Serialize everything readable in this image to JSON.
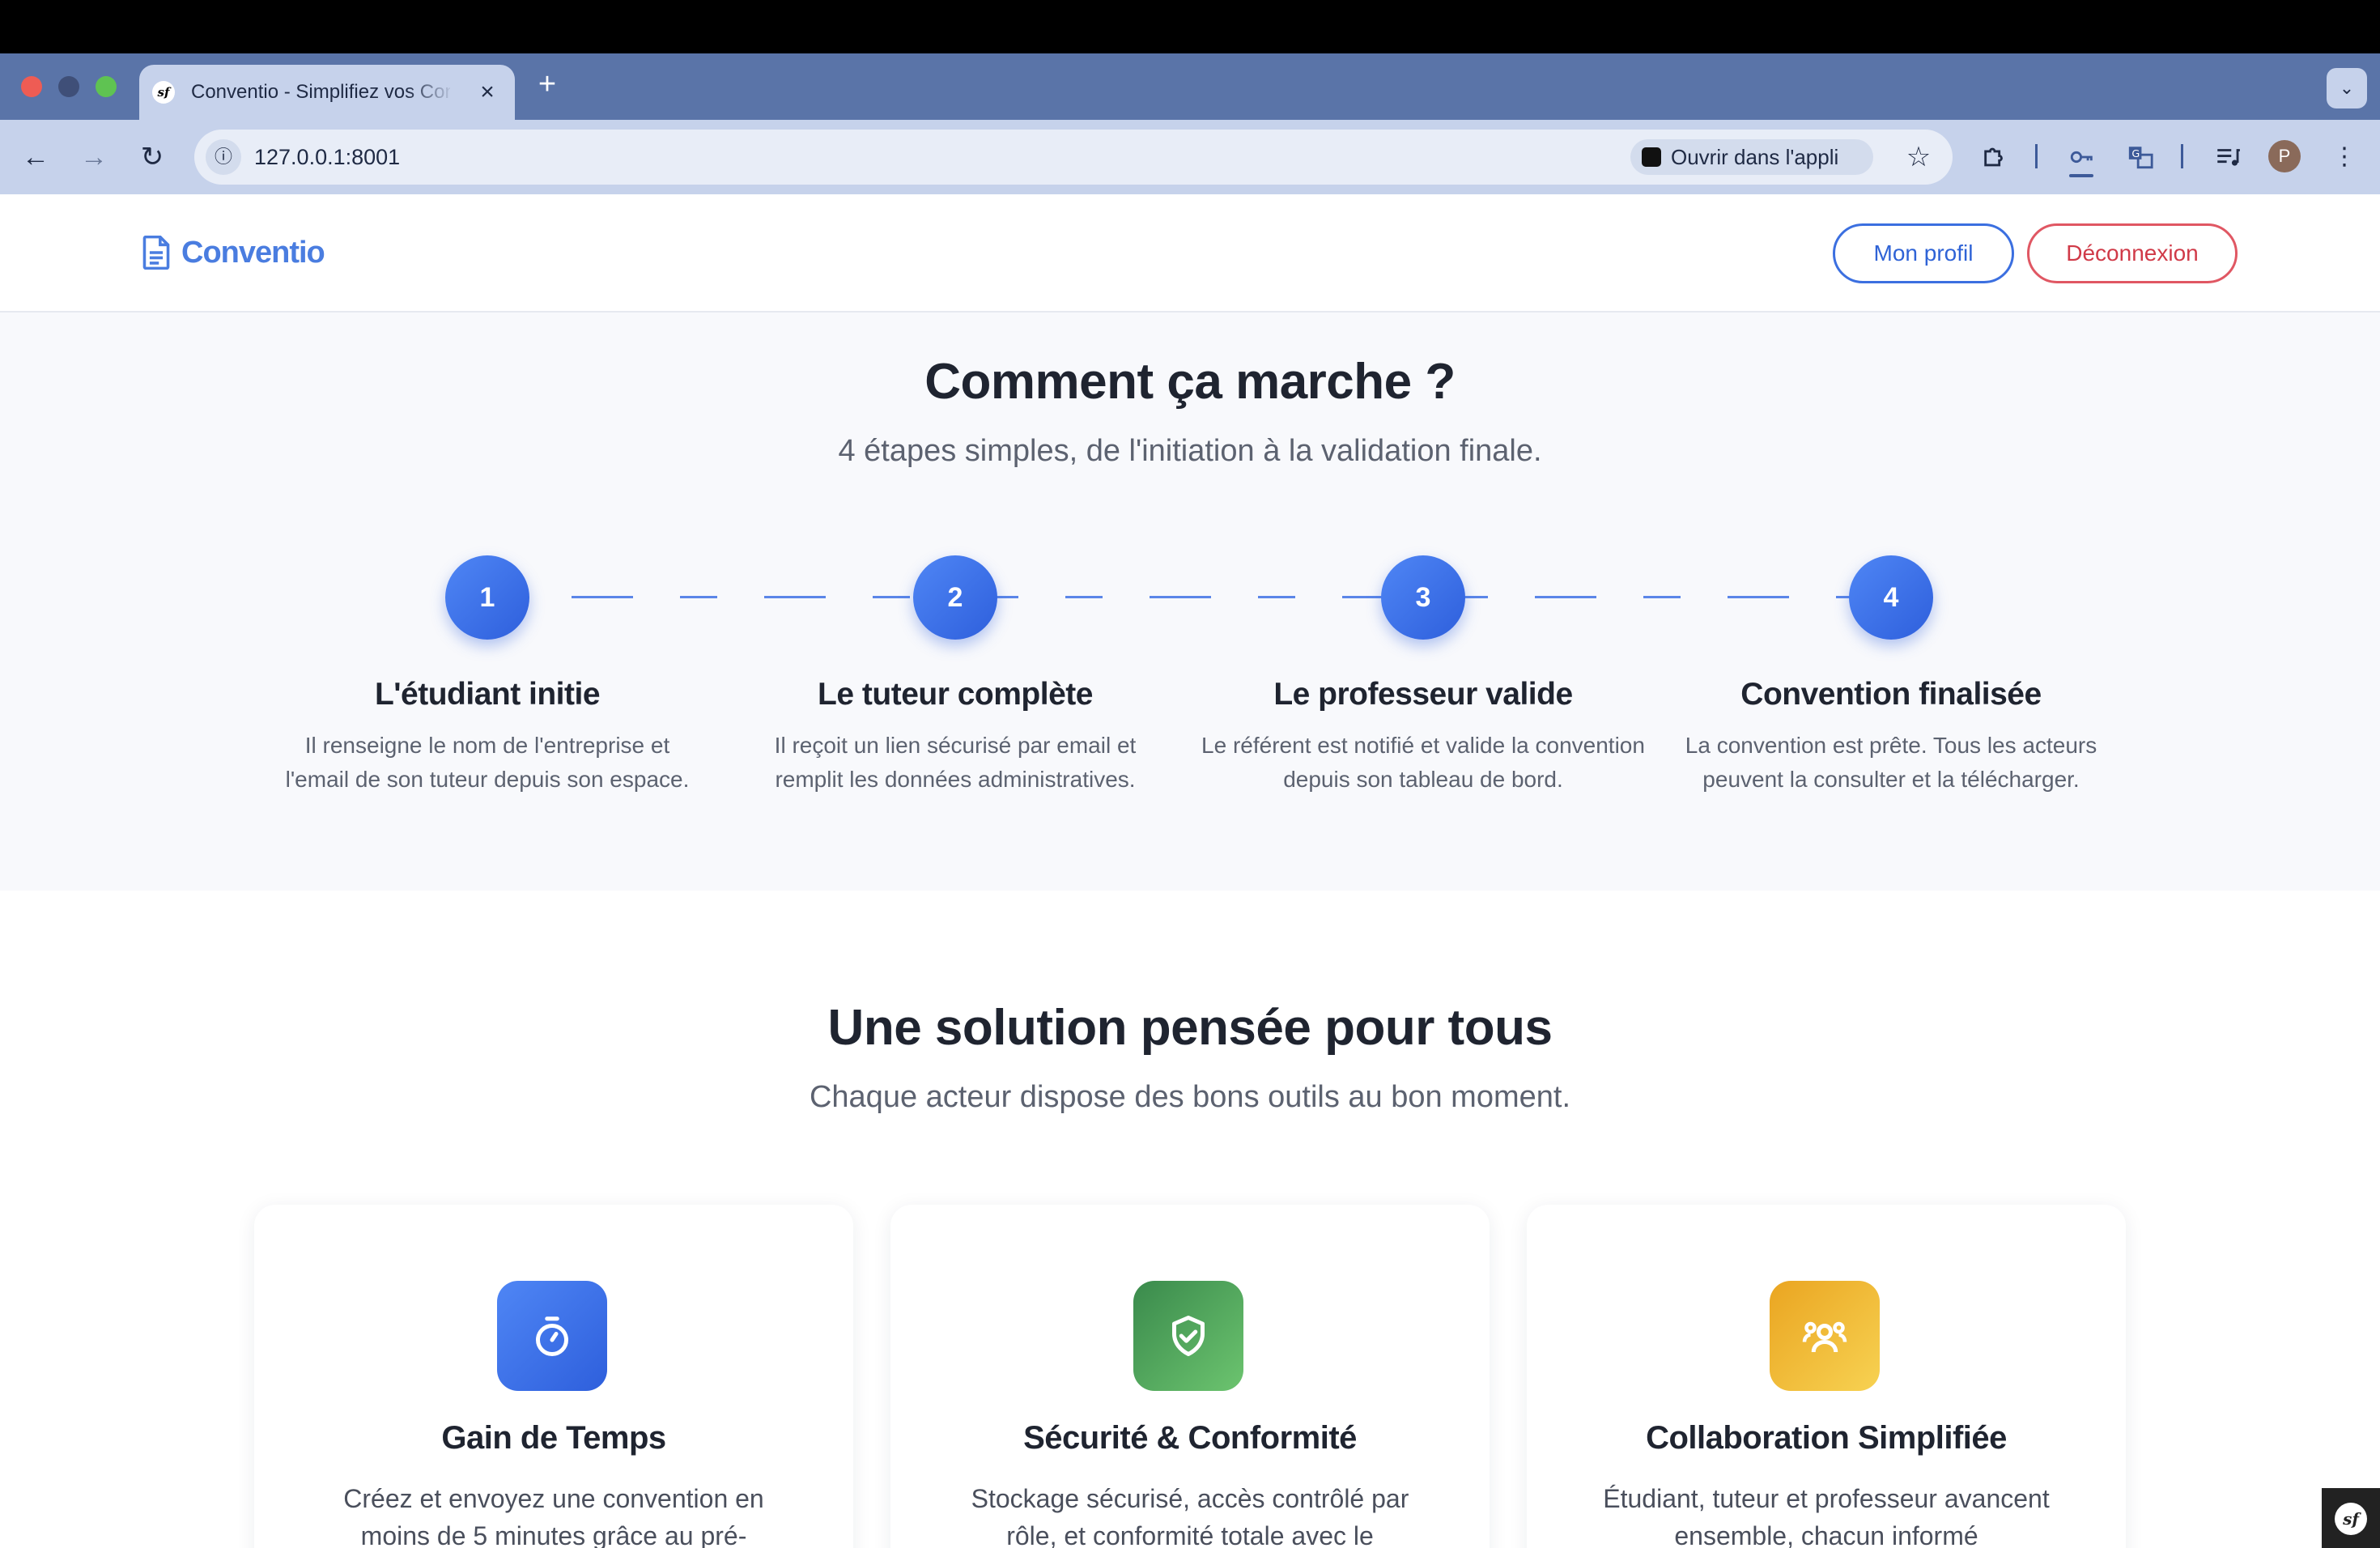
{
  "browser": {
    "tab_title": "Conventio - Simplifiez vos Conventions",
    "tab_favicon": "sf",
    "new_tab_label": "+",
    "url": "127.0.0.1:8001",
    "open_in_app_label": "Ouvrir dans l'appli",
    "profile_initial": "P"
  },
  "header": {
    "brand": "Conventio",
    "profile_button": "Mon profil",
    "logout_button": "Déconnexion"
  },
  "how_it_works": {
    "title": "Comment ça marche ?",
    "subtitle": "4 étapes simples, de l'initiation à la validation finale.",
    "steps": [
      {
        "number": "1",
        "title": "L'étudiant initie",
        "description": "Il renseigne le nom de l'entreprise et l'email de son tuteur depuis son espace."
      },
      {
        "number": "2",
        "title": "Le tuteur complète",
        "description": "Il reçoit un lien sécurisé par email et remplit les données administratives."
      },
      {
        "number": "3",
        "title": "Le professeur valide",
        "description": "Le référent est notifié et valide la convention depuis son tableau de bord."
      },
      {
        "number": "4",
        "title": "Convention finalisée",
        "description": "La convention est prête. Tous les acteurs peuvent la consulter et la télécharger."
      }
    ]
  },
  "features": {
    "title": "Une solution pensée pour tous",
    "subtitle": "Chaque acteur dispose des bons outils au bon moment.",
    "cards": [
      {
        "icon": "stopwatch-icon",
        "color": "#3b6fe0",
        "title": "Gain de Temps",
        "description": "Créez et envoyez une convention en moins de 5 minutes grâce au pré-"
      },
      {
        "icon": "shield-check-icon",
        "color": "#3f9a54",
        "title": "Sécurité & Conformité",
        "description": "Stockage sécurisé, accès contrôlé par rôle, et conformité totale avec le"
      },
      {
        "icon": "users-icon",
        "color": "#f0b030",
        "title": "Collaboration Simplifiée",
        "description": "Étudiant, tuteur et professeur avancent ensemble, chacun informé"
      }
    ]
  },
  "colors": {
    "accent": "#3b6fe0",
    "danger": "#d03a48",
    "green": "#3f9a54",
    "yellow": "#f0b030"
  }
}
